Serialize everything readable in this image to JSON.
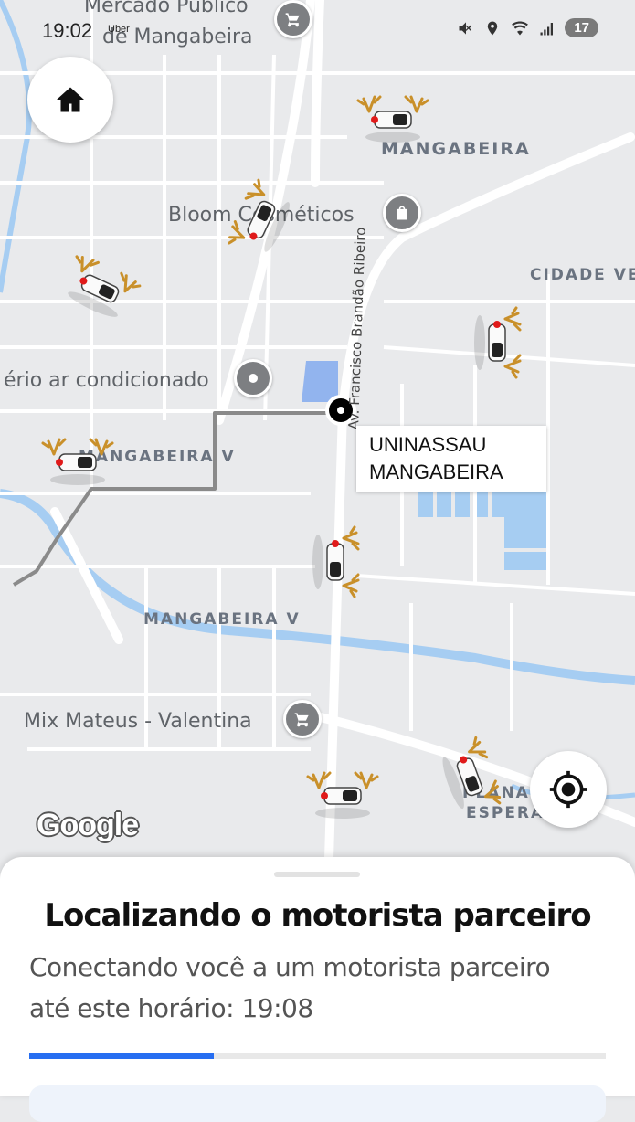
{
  "status_bar": {
    "time": "19:02",
    "notif": "Uber",
    "battery": "17"
  },
  "map": {
    "poi_labels": {
      "mercado_line1": "Mercado Público",
      "mercado_line2": "de Mangabeira",
      "bloom": "Bloom Cosméticos",
      "ar_condicionado": "ério ar condicionado",
      "mix_mateus": "Mix Mateus - Valentina"
    },
    "area_labels": {
      "mangabeira": "MANGABEIRA",
      "cidade_verde": "CIDADE VE",
      "mangabeira_v_upper": "MANGABEIRA V",
      "mangabeira_v_lower": "MANGABEIRA V",
      "planalto_1": "PLANALTO",
      "planalto_2": "ESPERAN"
    },
    "street_label": "Av. Francisco Brandão Ribeiro",
    "destination_line1": "UNINASSAU",
    "destination_line2": "MANGABEIRA",
    "attribution": "Google",
    "nearby_driver_count": 9
  },
  "sheet": {
    "title": "Localizando o motorista parceiro",
    "subtitle": "Conectando você a um motorista parceiro até este horário: 19:08",
    "progress_fraction": 0.32
  },
  "colors": {
    "accent": "#276ef1",
    "route": "#8a8a8a",
    "water": "#a6cdf2"
  },
  "icons": {
    "home": "home-icon",
    "locate": "locate-icon",
    "cart": "cart-icon",
    "bag": "shopping-bag-icon",
    "place": "place-icon"
  }
}
